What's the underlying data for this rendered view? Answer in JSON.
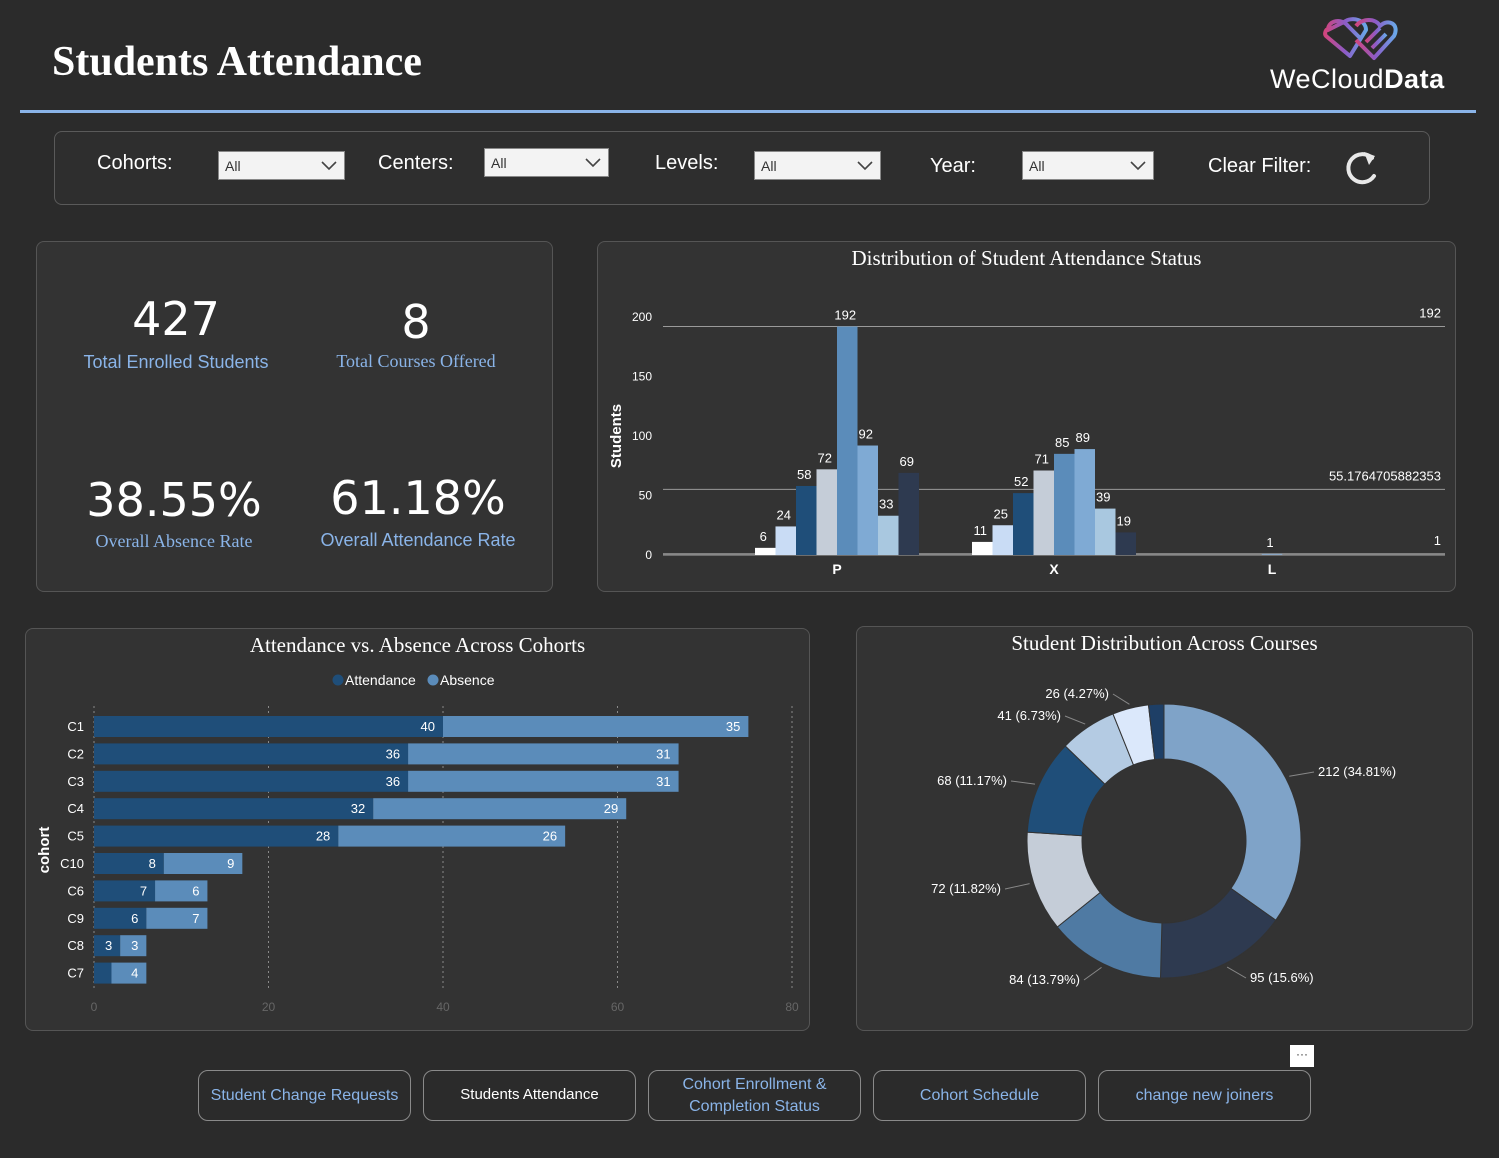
{
  "header": {
    "title": "Students Attendance",
    "logo_text_light": "WeCloud",
    "logo_text_bold": "Data"
  },
  "filters": {
    "cohorts_label": "Cohorts:",
    "cohorts_value": "All",
    "centers_label": "Centers:",
    "centers_value": "All",
    "levels_label": "Levels:",
    "levels_value": "All",
    "year_label": "Year:",
    "year_value": "All",
    "clear_label": "Clear Filter:"
  },
  "kpis": {
    "enrolled_value": "427",
    "enrolled_label": "Total Enrolled Students",
    "courses_value": "8",
    "courses_label": "Total Courses Offered",
    "absence_value": "38.55%",
    "absence_label": "Overall Absence Rate",
    "attendance_value": "61.18%",
    "attendance_label": "Overall Attendance Rate"
  },
  "colors": {
    "accent": "#8ab4e8",
    "background": "#2b2b2b",
    "panel": "#333333",
    "attendance": "#1f4e79",
    "absence": "#5b8cba"
  },
  "chart_data": [
    {
      "type": "bar",
      "title": "Distribution of Student Attendance Status",
      "ylabel": "Students",
      "xlabel": "",
      "categories": [
        "P",
        "X",
        "L"
      ],
      "ylim": [
        0,
        200
      ],
      "yticks": [
        0,
        50,
        100,
        150,
        200
      ],
      "series_colors": [
        "#ffffff",
        "#c9dcf5",
        "#1f4e79",
        "#c5cdd8",
        "#5b8cba",
        "#7faad4",
        "#a9c8e0",
        "#2e3a50"
      ],
      "groups": [
        {
          "category": "P",
          "values": [
            6,
            24,
            58,
            72,
            192,
            92,
            33,
            69
          ]
        },
        {
          "category": "X",
          "values": [
            11,
            25,
            52,
            71,
            85,
            89,
            39,
            19
          ]
        },
        {
          "category": "L",
          "values": [
            1
          ]
        }
      ],
      "reference_lines": [
        {
          "value": 192,
          "label": "192"
        },
        {
          "value": 55.1764705882353,
          "label": "55.1764705882353"
        },
        {
          "value": 1,
          "label": "1"
        }
      ]
    },
    {
      "type": "bar",
      "orientation": "horizontal",
      "stacked": true,
      "title": "Attendance vs. Absence Across Cohorts",
      "ylabel": "cohort",
      "xlabel": "",
      "categories": [
        "C1",
        "C2",
        "C3",
        "C4",
        "C5",
        "C10",
        "C6",
        "C9",
        "C8",
        "C7"
      ],
      "xlim": [
        0,
        80
      ],
      "xticks": [
        0,
        20,
        40,
        60,
        80
      ],
      "legend_position": "top",
      "series": [
        {
          "name": "Attendance",
          "color": "#1f4e79",
          "values": [
            40,
            36,
            36,
            32,
            28,
            8,
            7,
            6,
            3,
            2
          ]
        },
        {
          "name": "Absence",
          "color": "#5b8cba",
          "values": [
            35,
            31,
            31,
            29,
            26,
            9,
            6,
            7,
            3,
            4
          ]
        }
      ],
      "data_labels": {
        "Attendance": [
          "40",
          "36",
          "36",
          "32",
          "28",
          "8",
          "7",
          "6",
          "3",
          ""
        ],
        "Absence": [
          "35",
          "31",
          "31",
          "29",
          "26",
          "9",
          "6",
          "7",
          "3",
          "4"
        ]
      }
    },
    {
      "type": "pie",
      "donut": true,
      "title": "Student Distribution Across Courses",
      "slices": [
        {
          "value": 212,
          "label": "212 (34.81%)",
          "color": "#7fa3c8"
        },
        {
          "value": 95,
          "label": "95 (15.6%)",
          "color": "#2e3a50"
        },
        {
          "value": 84,
          "label": "84 (13.79%)",
          "color": "#4f7aa3"
        },
        {
          "value": 72,
          "label": "72 (11.82%)",
          "color": "#c5cdd8"
        },
        {
          "value": 68,
          "label": "68 (11.17%)",
          "color": "#1f4e79"
        },
        {
          "value": 41,
          "label": "41 (6.73%)",
          "color": "#b4cbe3"
        },
        {
          "value": 26,
          "label": "26 (4.27%)",
          "color": "#dbe8fb"
        },
        {
          "value": 11,
          "label": "",
          "color": "#1e3f66"
        }
      ]
    }
  ],
  "nav": {
    "btn1": "Student Change Requests",
    "btn2": "Students Attendance",
    "btn3_line1": "Cohort Enrollment &",
    "btn3_line2": "Completion Status",
    "btn4": "Cohort Schedule",
    "btn5": "change new joiners",
    "more": "···"
  }
}
